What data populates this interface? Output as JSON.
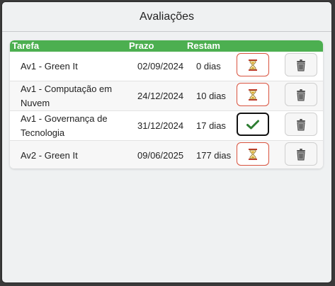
{
  "window": {
    "title": "Avaliações"
  },
  "table": {
    "headers": {
      "task": "Tarefa",
      "due": "Prazo",
      "remaining": "Restam"
    },
    "rows": [
      {
        "task": "Av1 - Green It",
        "due": "02/09/2024",
        "remaining": "0 dias",
        "status": "pending"
      },
      {
        "task": "Av1 - Computação em Nuvem",
        "due": "24/12/2024",
        "remaining": "10 dias",
        "status": "pending"
      },
      {
        "task": "Av1 - Governança de Tecnologia",
        "due": "31/12/2024",
        "remaining": "17 dias",
        "status": "done"
      },
      {
        "task": "Av2 - Green It",
        "due": "09/06/2025",
        "remaining": "177 dias",
        "status": "pending"
      }
    ]
  },
  "icons": {
    "pending": "hourglass-icon",
    "done": "checkmark-icon",
    "delete": "trash-icon"
  },
  "colors": {
    "header": "#4caf50",
    "pending_border": "#d9533f",
    "done_border": "#111111",
    "check": "#2e7d32"
  }
}
